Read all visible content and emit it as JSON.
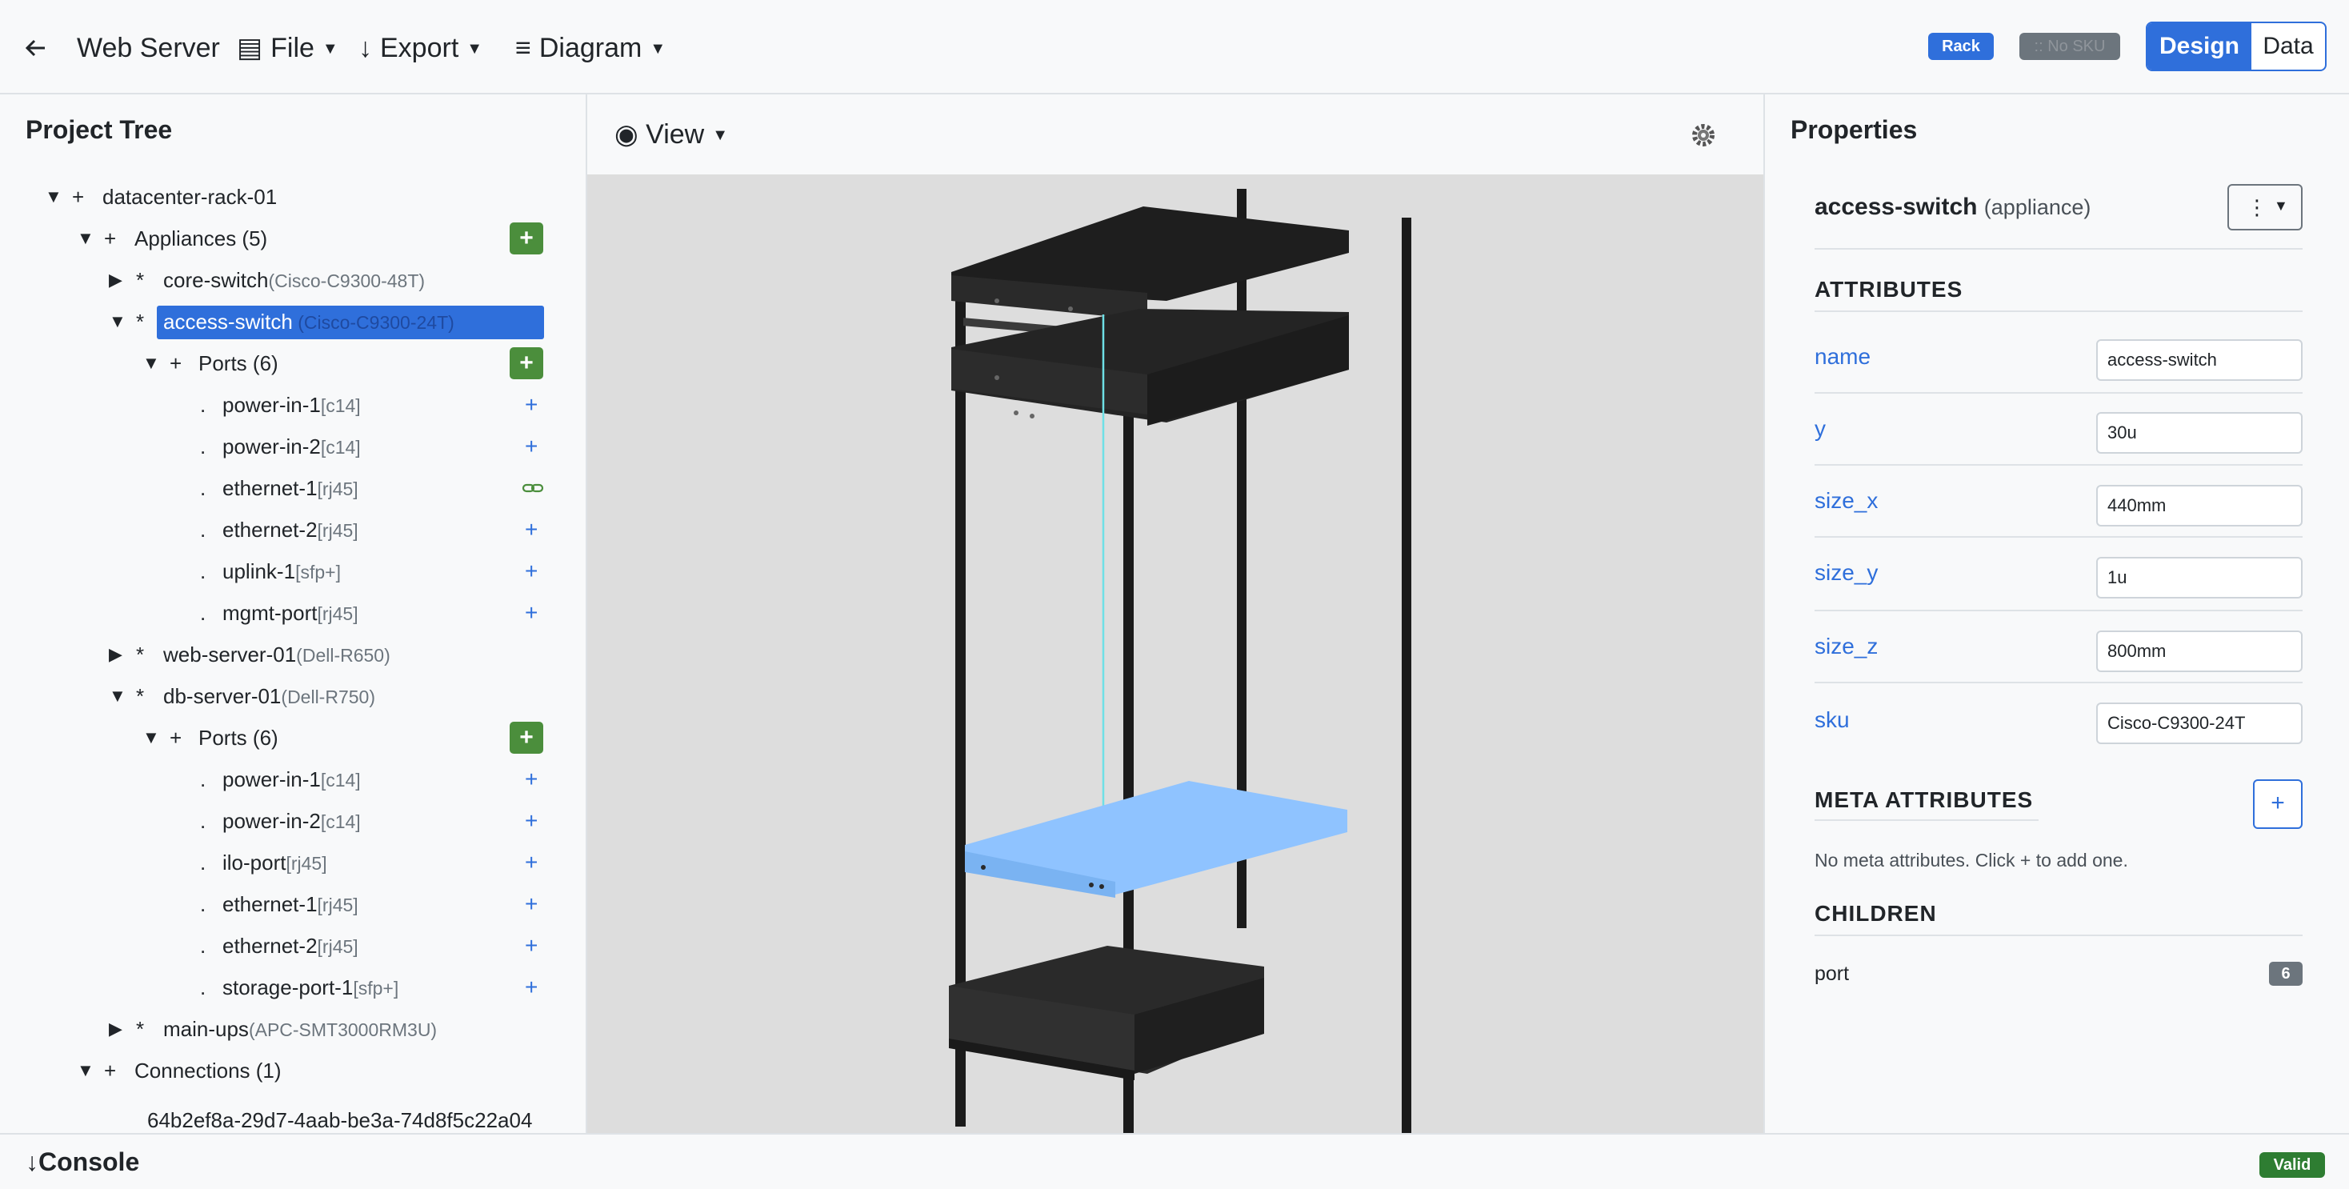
{
  "header": {
    "back_icon": "arrow-left-icon",
    "title": "Web Server",
    "menus": [
      {
        "icon": "▤",
        "label": "File"
      },
      {
        "icon": "↓",
        "label": "Export"
      },
      {
        "icon": "≡",
        "label": "Diagram"
      }
    ],
    "badge_rack": "Rack",
    "badge_nosku": ":: No SKU",
    "mode_design": "Design",
    "mode_data": "Data"
  },
  "project_tree": {
    "title": "Project Tree",
    "rows": [
      {
        "label": "datacenter-rack-01",
        "sub": ""
      },
      {
        "label": "Appliances (5)",
        "sub": ""
      },
      {
        "label": "core-switch",
        "sub": "(Cisco-C9300-48T)"
      },
      {
        "label": "access-switch",
        "sub": " (Cisco-C9300-24T)"
      },
      {
        "label": "Ports (6)",
        "sub": ""
      },
      {
        "label": "power-in-1",
        "sub": "[c14]"
      },
      {
        "label": "power-in-2",
        "sub": "[c14]"
      },
      {
        "label": "ethernet-1",
        "sub": "[rj45]"
      },
      {
        "label": "ethernet-2",
        "sub": "[rj45]"
      },
      {
        "label": "uplink-1",
        "sub": "[sfp+]"
      },
      {
        "label": "mgmt-port",
        "sub": "[rj45]"
      },
      {
        "label": "web-server-01",
        "sub": "(Dell-R650)"
      },
      {
        "label": "db-server-01",
        "sub": "(Dell-R750)"
      },
      {
        "label": "Ports (6)",
        "sub": ""
      },
      {
        "label": "power-in-1",
        "sub": "[c14]"
      },
      {
        "label": "power-in-2",
        "sub": "[c14]"
      },
      {
        "label": "ilo-port",
        "sub": "[rj45]"
      },
      {
        "label": "ethernet-1",
        "sub": "[rj45]"
      },
      {
        "label": "ethernet-2",
        "sub": "[rj45]"
      },
      {
        "label": "storage-port-1",
        "sub": "[sfp+]"
      },
      {
        "label": "main-ups",
        "sub": "(APC-SMT3000RM3U)"
      },
      {
        "label": "Connections (1)",
        "sub": ""
      },
      {
        "label": "64b2ef8a-29d7-4aab-be3a-74d8f5c22a04",
        "sub": ""
      }
    ]
  },
  "view": {
    "label": "View",
    "settings_icon": "gear-icon"
  },
  "properties": {
    "title": "Properties",
    "selected_name": "access-switch",
    "selected_type": "(appliance)",
    "attributes_title": "ATTRIBUTES",
    "attributes": [
      {
        "key": "name",
        "value": "access-switch"
      },
      {
        "key": "y",
        "value": "30u"
      },
      {
        "key": "size_x",
        "value": "440mm"
      },
      {
        "key": "size_y",
        "value": "1u"
      },
      {
        "key": "size_z",
        "value": "800mm"
      },
      {
        "key": "sku",
        "value": "Cisco-C9300-24T"
      }
    ],
    "meta_title": "META ATTRIBUTES",
    "meta_add": "+",
    "meta_empty": "No meta attributes. Click + to add one.",
    "children_title": "CHILDREN",
    "children": [
      {
        "name": "port",
        "count": "6"
      }
    ]
  },
  "footer": {
    "console": "↓Console",
    "status": "Valid"
  },
  "colors": {
    "accent": "#2f6fdb",
    "add_green": "#4b8e3c",
    "valid_green": "#2e7d32",
    "rack_black": "#1b1b1b",
    "selected_shelf": "#8fc3ff"
  }
}
